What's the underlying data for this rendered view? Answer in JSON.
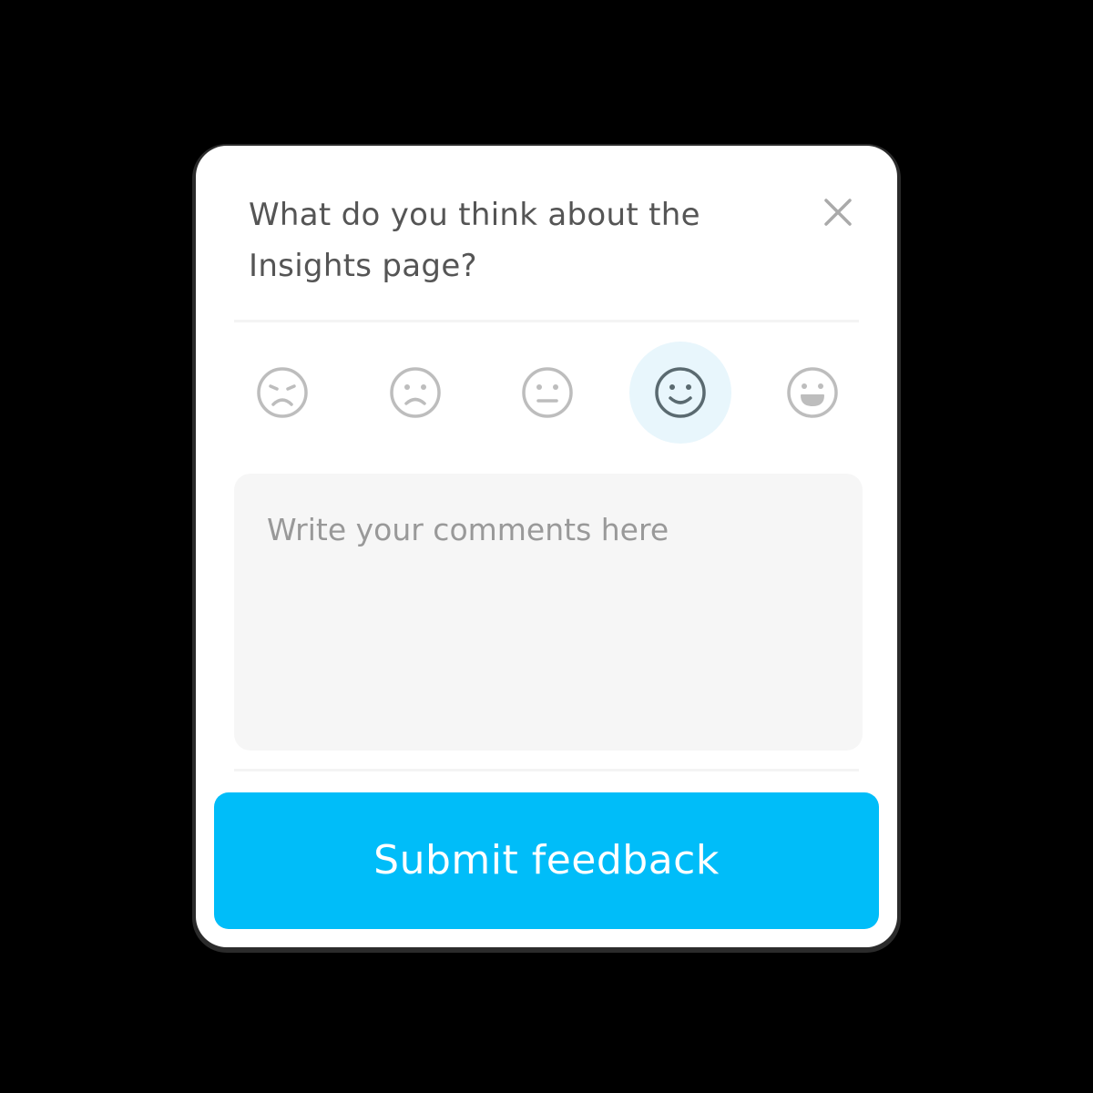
{
  "dialog": {
    "question": "What do you think about the Insights page?",
    "close_icon": "close-icon"
  },
  "rating": {
    "options": [
      {
        "icon": "very-dissatisfied-face-icon"
      },
      {
        "icon": "dissatisfied-face-icon"
      },
      {
        "icon": "neutral-face-icon"
      },
      {
        "icon": "satisfied-face-icon",
        "selected": true
      },
      {
        "icon": "very-satisfied-face-icon"
      }
    ],
    "selected_index": 3
  },
  "comments": {
    "placeholder": "Write your comments here",
    "value": ""
  },
  "submit": {
    "label": "Submit feedback"
  },
  "colors": {
    "accent": "#00bdf9",
    "selected_face_bg": "#e8f6fc",
    "face_stroke": "#bdbdbd",
    "selected_face_stroke": "#5a6a70",
    "text": "#555555",
    "placeholder": "#999999",
    "background": "#000000"
  }
}
